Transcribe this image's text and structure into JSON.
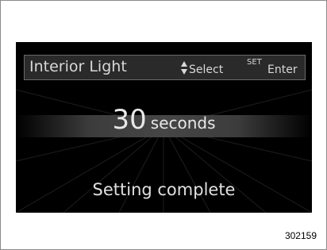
{
  "header": {
    "title": "Interior Light",
    "select_label": "Select",
    "set_label": "SET",
    "enter_label": "Enter"
  },
  "value": {
    "number": "30",
    "unit": "seconds"
  },
  "status": "Setting complete",
  "figure_number": "302159",
  "icons": {
    "updown": "up-down-triangle-icon"
  },
  "colors": {
    "screen_bg": "#000000",
    "header_bg": "#2a2a2a",
    "text": "#e0e0e0"
  }
}
